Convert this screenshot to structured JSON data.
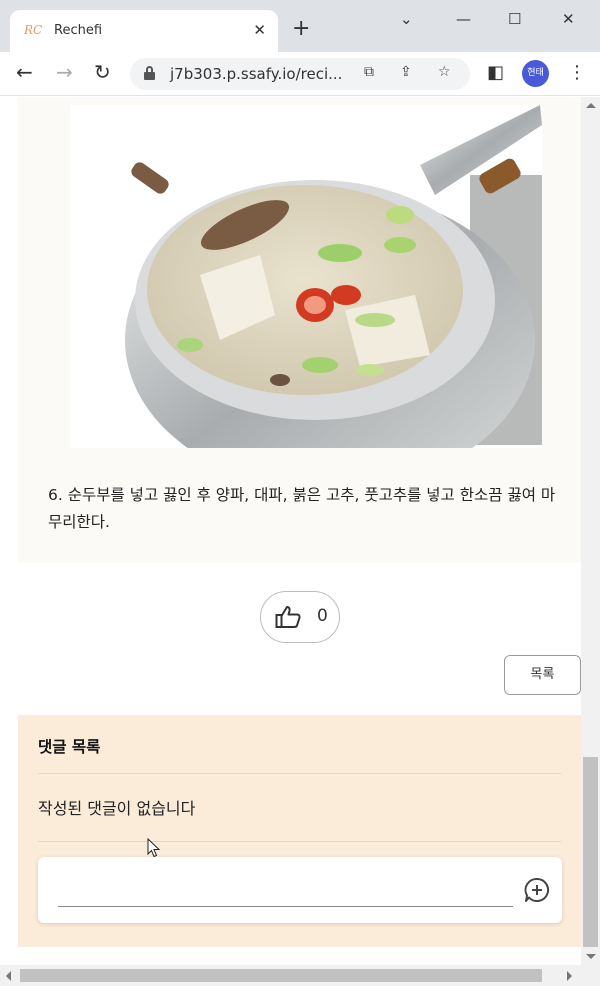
{
  "browser": {
    "tab_title": "Rechefi",
    "favicon_text": "RC",
    "url": "j7b303.p.ssafy.io/reci...",
    "profile_initials": "현태"
  },
  "recipe_step": {
    "text": "6. 순두부를 넣고 끓인 후 양파, 대파, 붉은 고추, 풋고추를 넣고 한소끔 끓여 마무리한다."
  },
  "like": {
    "count": "0"
  },
  "list_button": {
    "label": "목록"
  },
  "comments": {
    "title": "댓글 목록",
    "empty_text": "작성된 댓글이 없습니다"
  },
  "colors": {
    "comments_bg": "#fbebd9",
    "step_card_bg": "#fbfaf7",
    "avatar_bg": "#4a5ad6"
  }
}
